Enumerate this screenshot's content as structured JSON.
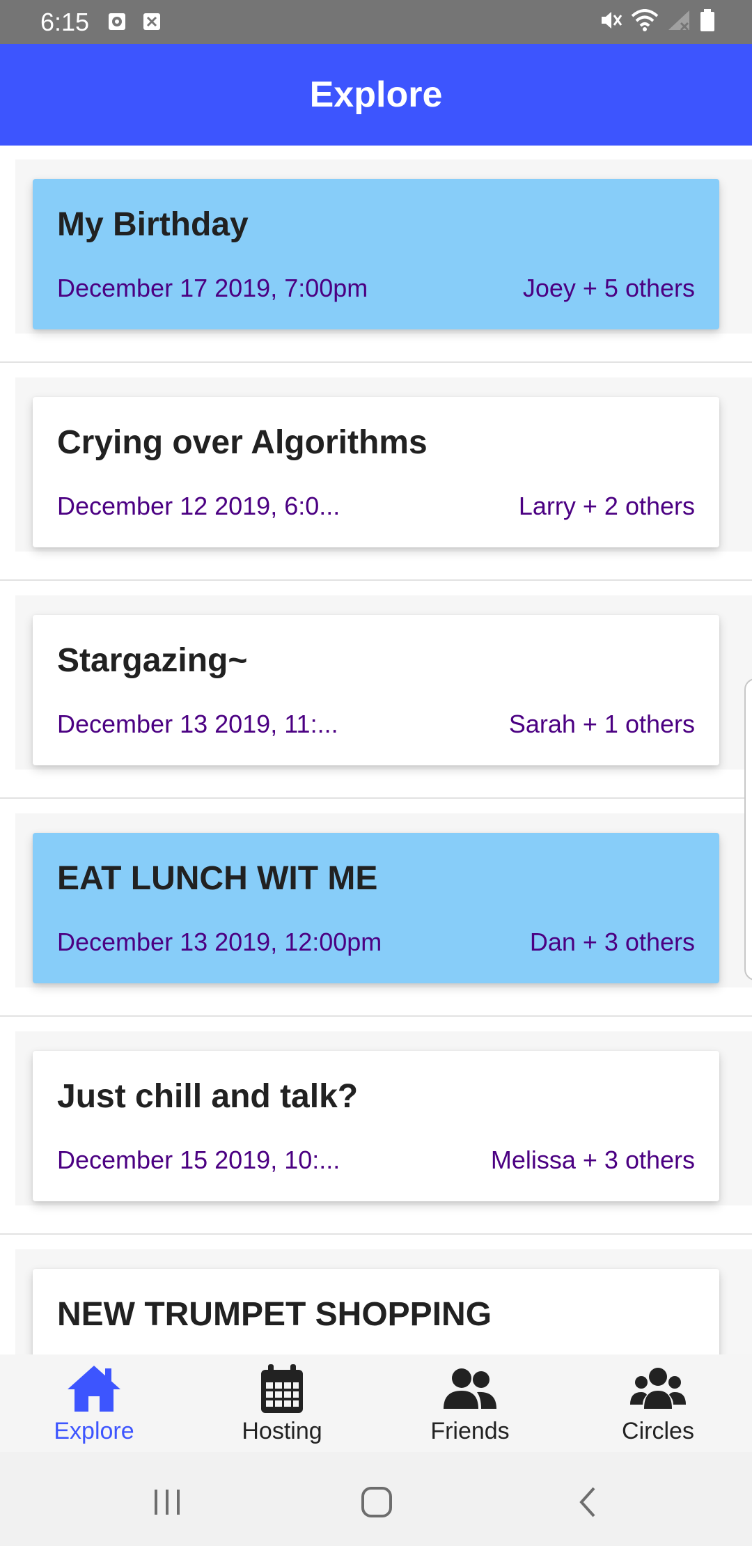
{
  "status_bar": {
    "time": "6:15"
  },
  "app_bar": {
    "title": "Explore",
    "background_color": "#3d55fe"
  },
  "events": [
    {
      "title": "My Birthday",
      "date": "December 17 2019, 7:00pm",
      "people": "Joey + 5 others",
      "highlighted": true
    },
    {
      "title": "Crying over Algorithms",
      "date": "December 12 2019, 6:0...",
      "people": "Larry + 2 others",
      "highlighted": false
    },
    {
      "title": "Stargazing~",
      "date": "December 13 2019, 11:...",
      "people": "Sarah + 1 others",
      "highlighted": false
    },
    {
      "title": "EAT LUNCH WIT ME",
      "date": "December 13 2019, 12:00pm",
      "people": "Dan + 3 others",
      "highlighted": true
    },
    {
      "title": "Just chill and talk?",
      "date": "December 15 2019, 10:...",
      "people": "Melissa + 3 others",
      "highlighted": false
    },
    {
      "title": "NEW TRUMPET SHOPPING",
      "date": "",
      "people": "",
      "highlighted": false
    }
  ],
  "colors": {
    "highlight_card": "#87cdf9",
    "meta_text": "#4b0082",
    "active_tab": "#3d55fe"
  },
  "tabs": [
    {
      "label": "Explore",
      "icon": "home-icon",
      "active": true
    },
    {
      "label": "Hosting",
      "icon": "calendar-icon",
      "active": false
    },
    {
      "label": "Friends",
      "icon": "friends-icon",
      "active": false
    },
    {
      "label": "Circles",
      "icon": "circles-icon",
      "active": false
    }
  ],
  "nav": {
    "recents": "recents-icon",
    "home": "home-button-icon",
    "back": "back-icon"
  }
}
